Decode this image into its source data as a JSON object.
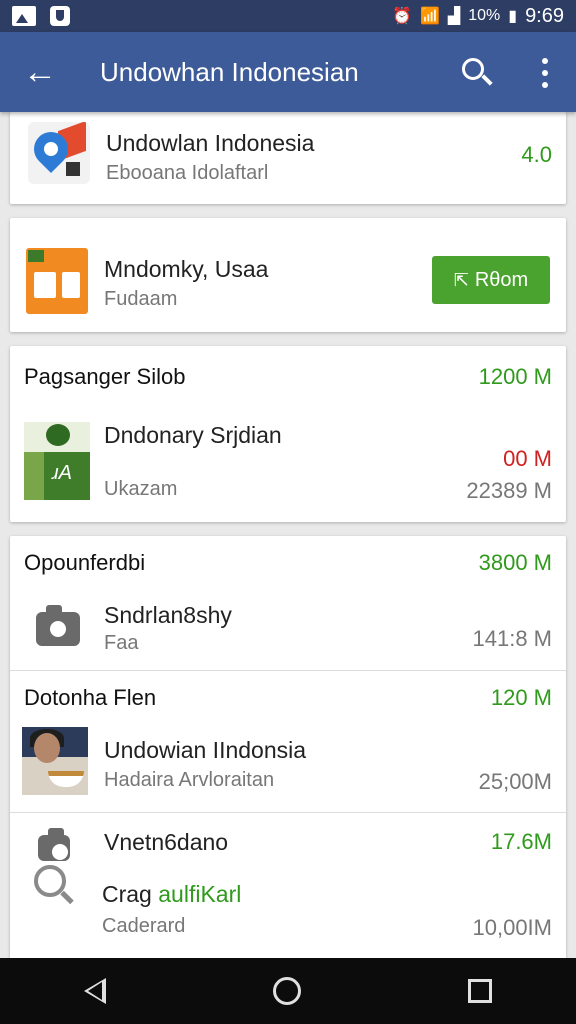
{
  "status_bar": {
    "signal_pct": "10%",
    "time": "9:69",
    "icons": [
      "image-icon",
      "shield-icon",
      "alarm-icon",
      "wifi-icon",
      "signal-icon",
      "battery-icon"
    ]
  },
  "app_bar": {
    "title": "Undowhan Indonesian",
    "back_icon": "arrow-left-icon",
    "search_icon": "search-icon",
    "more_icon": "more-vert-icon"
  },
  "card1": {
    "title": "Undowlan Indonesia",
    "subtitle": "Ebooana Idolaftarl",
    "value": "4.0"
  },
  "card2": {
    "title": "Mndomky, Usaa",
    "subtitle": "Fudaam",
    "button_label": "Rθom"
  },
  "card3": {
    "header": "Pagsanger Silob",
    "header_value": "1200 M",
    "title": "Dndonary Srjdian",
    "subtitle": "Ukazam",
    "value_red": "00 M",
    "value_gray": "22389 M"
  },
  "card4": {
    "section1": {
      "header": "Opounferdbi",
      "header_value": "3800 M",
      "title": "Sndrlan8shy",
      "subtitle": "Faa",
      "value": "141:8 M"
    },
    "section2": {
      "header": "Dotonha Flen",
      "header_value": "120 M",
      "title": "Undowian IIndonsia",
      "subtitle": "Hadaira Arvloraitan",
      "value": "25;00M"
    },
    "section3": {
      "title": "Vnetn6dano",
      "value": "17.6M",
      "title2": "Crag",
      "title2_accent": "aulfiKarl",
      "subtitle": "Caderard",
      "value2": "10,00IM"
    }
  },
  "colors": {
    "status_bar": "#2d3d63",
    "app_bar": "#3e5b99",
    "accent_green": "#2f9a1c",
    "button_green": "#4ba32f",
    "red": "#d21f1f"
  }
}
